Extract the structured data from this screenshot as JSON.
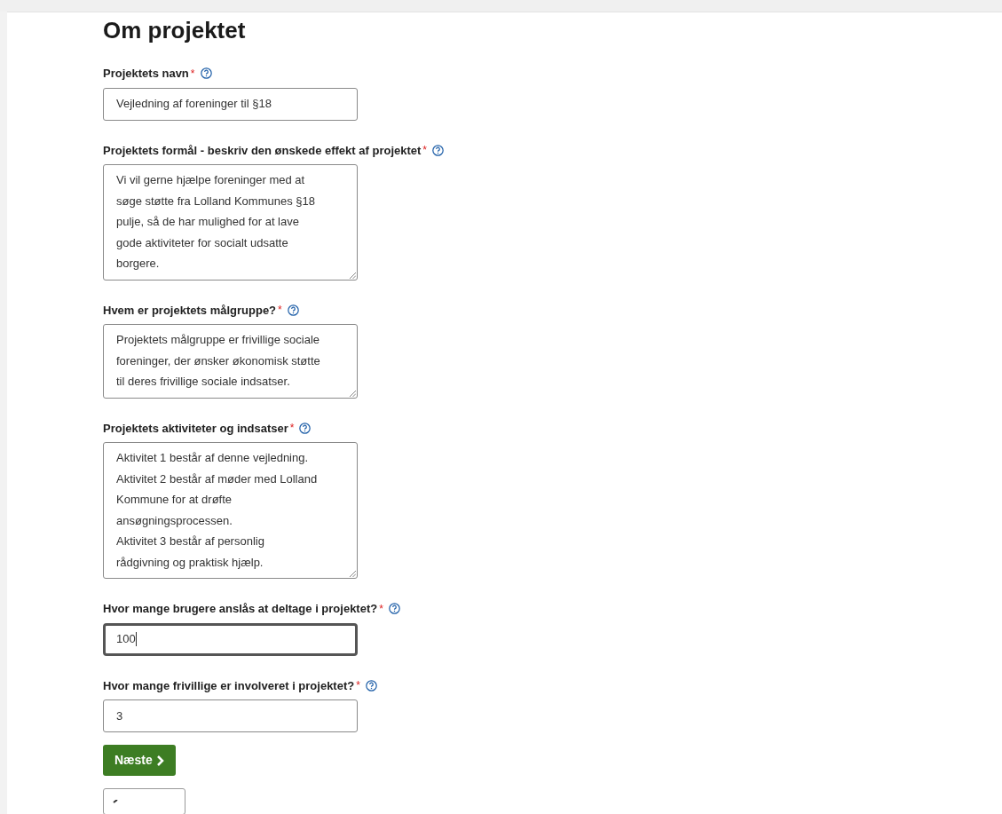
{
  "heading": "Om projektet",
  "fields": [
    {
      "kind": "input",
      "label": "Projektets navn",
      "required": true,
      "required_mark": "*",
      "focused": false,
      "lines": [
        "Vejledning af foreninger til §18"
      ]
    },
    {
      "kind": "textarea",
      "label": "Projektets formål - beskriv den ønskede effekt af projektet",
      "required": true,
      "required_mark": "*",
      "focused": false,
      "lines": [
        "Vi vil gerne hjælpe foreninger med at",
        "søge støtte fra Lolland Kommunes §18",
        "pulje, så de har mulighed for at lave",
        "gode aktiviteter for socialt udsatte",
        "borgere."
      ]
    },
    {
      "kind": "textarea",
      "label": "Hvem er projektets målgruppe?",
      "required": true,
      "required_mark": "*",
      "focused": false,
      "lines": [
        "Projektets målgruppe er frivillige sociale",
        "foreninger, der ønsker økonomisk støtte",
        "til deres frivillige sociale indsatser."
      ]
    },
    {
      "kind": "textarea",
      "label": "Projektets aktiviteter og indsatser",
      "required": true,
      "required_mark": "*",
      "focused": false,
      "lines": [
        "Aktivitet 1 består af denne vejledning.",
        "Aktivitet 2 består af møder med Lolland",
        "Kommune for at drøfte",
        "ansøgningsprocessen.",
        "Aktivitet 3 består af personlig",
        "rådgivning og praktisk hjælp."
      ]
    },
    {
      "kind": "input",
      "label": "Hvor mange brugere anslås at deltage i projektet?",
      "required": true,
      "required_mark": "*",
      "focused": true,
      "lines": [
        "100"
      ]
    },
    {
      "kind": "input",
      "label": "Hvor mange frivillige er involveret i projektet?",
      "required": true,
      "required_mark": "*",
      "focused": false,
      "lines": [
        "3"
      ]
    }
  ],
  "next_button": {
    "label": "Næste"
  }
}
